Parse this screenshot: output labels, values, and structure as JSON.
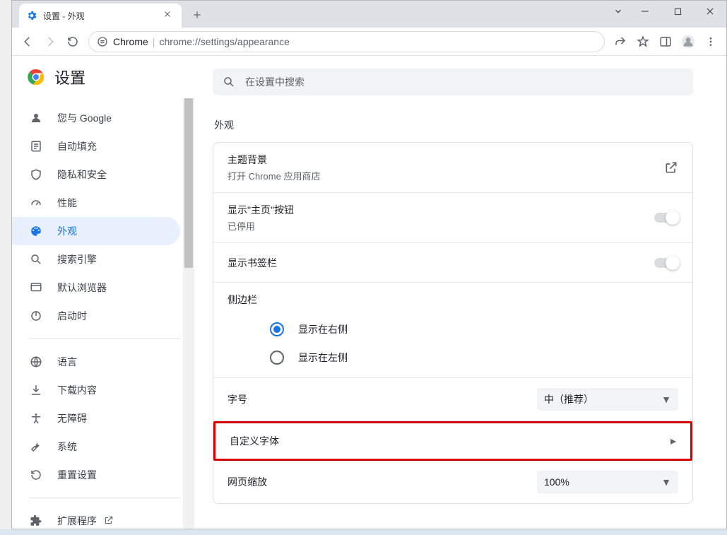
{
  "tab": {
    "title": "设置 - 外观"
  },
  "address": {
    "host": "Chrome",
    "path": "chrome://settings/appearance"
  },
  "settingsHeader": "设置",
  "search": {
    "placeholder": "在设置中搜索"
  },
  "sidebar": {
    "items": [
      {
        "label": "您与 Google"
      },
      {
        "label": "自动填充"
      },
      {
        "label": "隐私和安全"
      },
      {
        "label": "性能"
      },
      {
        "label": "外观"
      },
      {
        "label": "搜索引擎"
      },
      {
        "label": "默认浏览器"
      },
      {
        "label": "启动时"
      }
    ],
    "items2": [
      {
        "label": "语言"
      },
      {
        "label": "下载内容"
      },
      {
        "label": "无障碍"
      },
      {
        "label": "系统"
      },
      {
        "label": "重置设置"
      }
    ],
    "extensions": "扩展程序"
  },
  "section": {
    "title": "外观",
    "theme": {
      "title": "主题背景",
      "sub": "打开 Chrome 应用商店"
    },
    "homeButton": {
      "title": "显示\"主页\"按钮",
      "sub": "已停用"
    },
    "bookmarksBar": {
      "title": "显示书签栏"
    },
    "sidebarPos": {
      "title": "侧边栏",
      "options": [
        "显示在右侧",
        "显示在左侧"
      ],
      "selected": 0
    },
    "fontSize": {
      "title": "字号",
      "value": "中（推荐）"
    },
    "customFonts": {
      "title": "自定义字体"
    },
    "pageZoom": {
      "title": "网页缩放",
      "value": "100%"
    }
  }
}
